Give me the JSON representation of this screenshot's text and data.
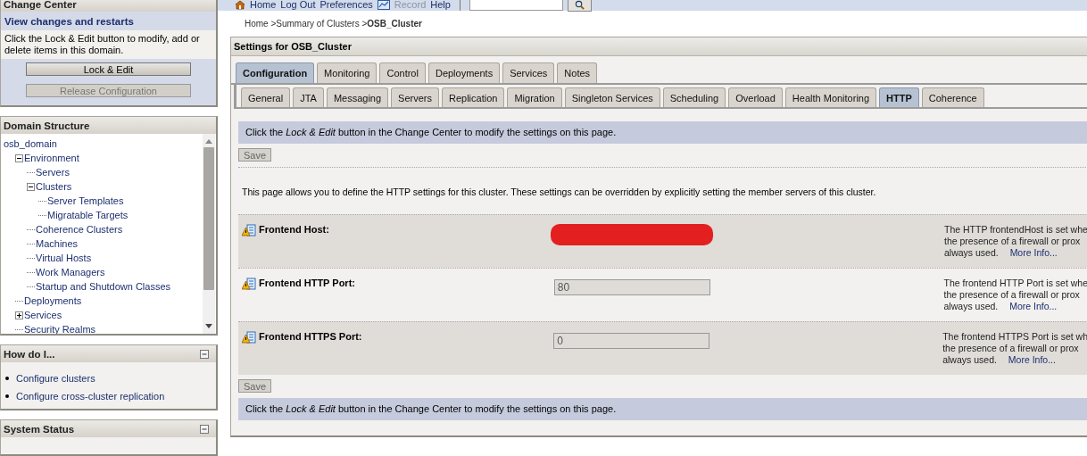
{
  "toolbar": {
    "items": [
      {
        "label": "Home",
        "disabled": false
      },
      {
        "label": "Log Out",
        "disabled": false
      },
      {
        "label": "Preferences",
        "disabled": false
      },
      {
        "label": "Record",
        "disabled": true
      },
      {
        "label": "Help",
        "disabled": false
      }
    ]
  },
  "change_center": {
    "title": "Change Center",
    "subtitle": "View changes and restarts",
    "message": "Click the Lock & Edit button to modify, add or delete items in this domain.",
    "buttons": [
      {
        "label": "Lock & Edit",
        "disabled": false
      },
      {
        "label": "Release Configuration",
        "disabled": true
      }
    ]
  },
  "domain_structure": {
    "title": "Domain Structure",
    "tree": [
      {
        "label": "osb_domain",
        "children": [
          {
            "label": "Environment",
            "expanded": true,
            "children": [
              {
                "label": "Servers"
              },
              {
                "label": "Clusters",
                "expanded": true,
                "children": [
                  {
                    "label": "Server Templates"
                  },
                  {
                    "label": "Migratable Targets"
                  }
                ]
              },
              {
                "label": "Coherence Clusters"
              },
              {
                "label": "Machines"
              },
              {
                "label": "Virtual Hosts"
              },
              {
                "label": "Work Managers"
              },
              {
                "label": "Startup and Shutdown Classes"
              }
            ]
          },
          {
            "label": "Deployments"
          },
          {
            "label": "Services",
            "expanded": false
          },
          {
            "label": "Security Realms"
          }
        ]
      }
    ]
  },
  "how_do_i": {
    "title": "How do I...",
    "links": [
      "Configure clusters",
      "Configure cross-cluster replication"
    ]
  },
  "system_status": {
    "title": "System Status"
  },
  "breadcrumb": {
    "items": [
      "Home >Summary of Clusters >"
    ],
    "current": "OSB_Cluster"
  },
  "settings": {
    "title": "Settings for OSB_Cluster",
    "tabs": [
      {
        "label": "Configuration",
        "selected": true
      },
      {
        "label": "Monitoring",
        "selected": false
      },
      {
        "label": "Control",
        "selected": false
      },
      {
        "label": "Deployments",
        "selected": false
      },
      {
        "label": "Services",
        "selected": false
      },
      {
        "label": "Notes",
        "selected": false
      }
    ],
    "subtabs": [
      {
        "label": "General",
        "selected": false
      },
      {
        "label": "JTA",
        "selected": false
      },
      {
        "label": "Messaging",
        "selected": false
      },
      {
        "label": "Servers",
        "selected": false
      },
      {
        "label": "Replication",
        "selected": false
      },
      {
        "label": "Migration",
        "selected": false
      },
      {
        "label": "Singleton Services",
        "selected": false
      },
      {
        "label": "Scheduling",
        "selected": false
      },
      {
        "label": "Overload",
        "selected": false
      },
      {
        "label": "Health Monitoring",
        "selected": false
      },
      {
        "label": "HTTP",
        "selected": true
      },
      {
        "label": "Coherence",
        "selected": false
      }
    ],
    "notice_top": "Click the *Lock & Edit* button in the Change Center to modify the settings on this page.",
    "save_top": "Save",
    "save_bottom": "Save",
    "notice_bottom": "Click the *Lock & Edit* button in the Change Center to modify the settings on this page.",
    "description": "This page allows you to define the HTTP settings for this cluster. These settings can be overridden by explicitly setting the member servers of this cluster.",
    "fields": [
      {
        "label": "Frontend Host:",
        "redacted": true,
        "help": [
          "The HTTP frontendHost is set whe",
          "the presence of a firewall or prox",
          "always used."
        ],
        "more": "More Info..."
      },
      {
        "label": "Frontend HTTP Port:",
        "value": "80",
        "redacted": false,
        "help": [
          "The frontend HTTP Port is set whe",
          "the presence of a firewall or prox",
          "always used."
        ],
        "more": "More Info..."
      },
      {
        "label": "Frontend HTTPS Port:",
        "value": "0",
        "redacted": false,
        "help": [
          "The frontend HTTPS Port is set wh",
          "the presence of a firewall or prox",
          "always used."
        ],
        "more": "More Info..."
      }
    ]
  }
}
